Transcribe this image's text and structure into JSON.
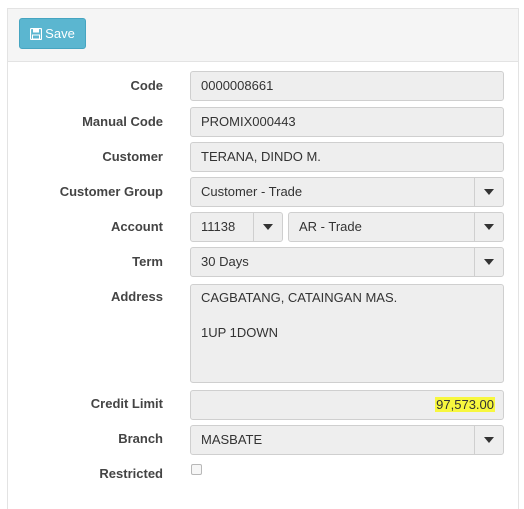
{
  "toolbar": {
    "save_label": "Save",
    "save_icon": "floppy-disk-icon"
  },
  "form": {
    "code": {
      "label": "Code",
      "value": "0000008661"
    },
    "manual_code": {
      "label": "Manual Code",
      "value": "PROMIX000443"
    },
    "customer": {
      "label": "Customer",
      "value": "TERANA, DINDO M."
    },
    "customer_group": {
      "label": "Customer Group",
      "value": "Customer - Trade"
    },
    "account": {
      "label": "Account",
      "number": "11138",
      "name": "AR - Trade"
    },
    "term": {
      "label": "Term",
      "value": "30 Days"
    },
    "address": {
      "label": "Address",
      "line1": "CAGBATANG, CATAINGAN MAS.",
      "line2": "1UP 1DOWN"
    },
    "credit_limit": {
      "label": "Credit Limit",
      "value": "97,573.00",
      "highlight_color": "#f7f73e"
    },
    "branch": {
      "label": "Branch",
      "value": "MASBATE"
    },
    "restricted": {
      "label": "Restricted",
      "checked": false
    }
  }
}
